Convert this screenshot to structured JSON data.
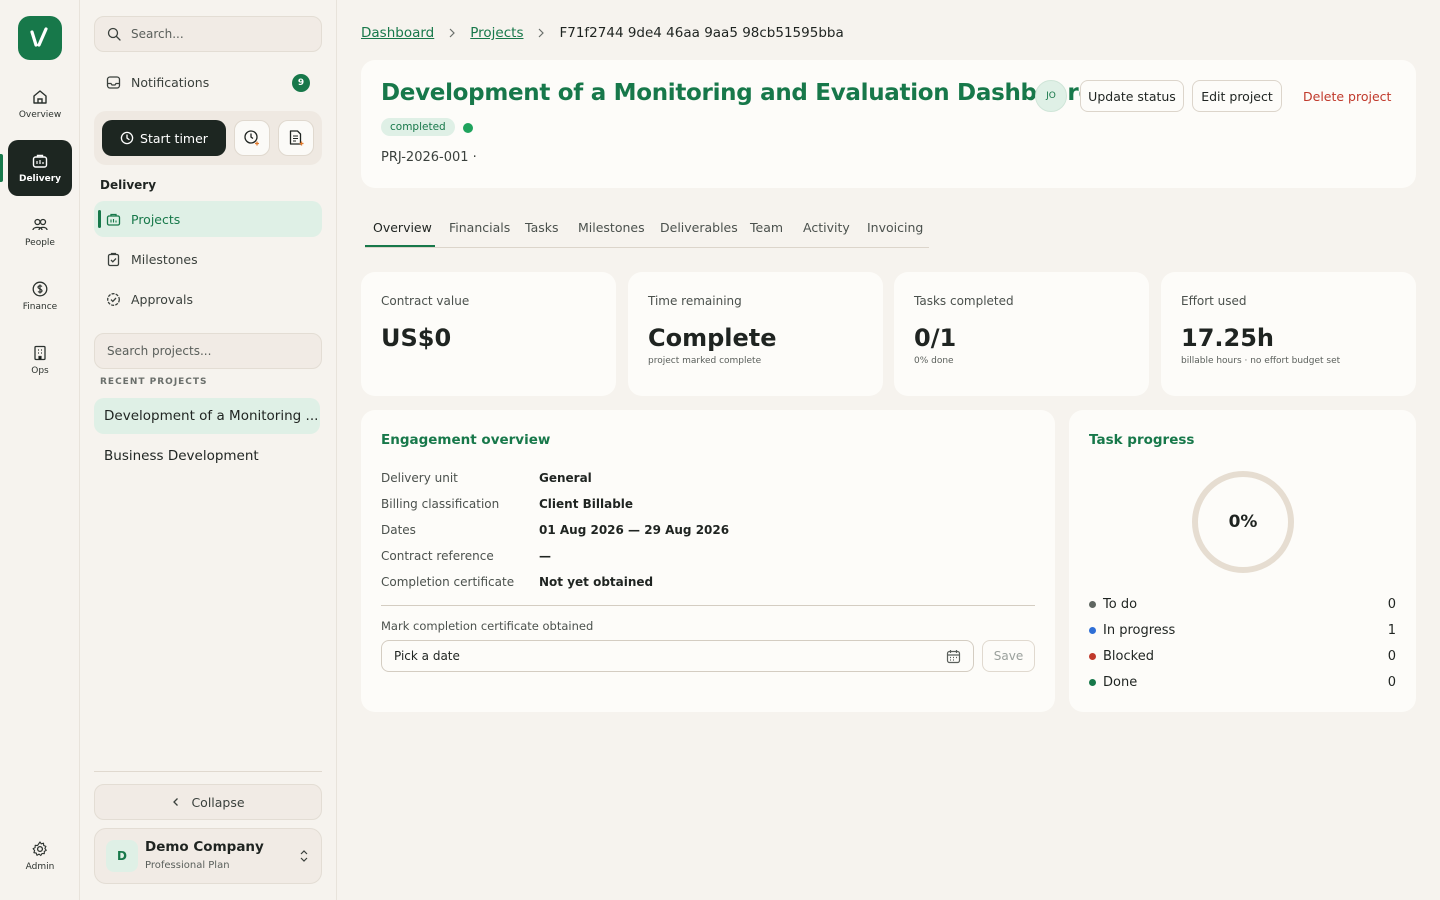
{
  "rail": {
    "items": [
      {
        "label": "Overview",
        "icon": "home-icon"
      },
      {
        "label": "Delivery",
        "icon": "briefcase-icon"
      },
      {
        "label": "People",
        "icon": "people-icon"
      },
      {
        "label": "Finance",
        "icon": "dollar-circle-icon"
      },
      {
        "label": "Ops",
        "icon": "building-icon"
      }
    ],
    "admin_label": "Admin"
  },
  "sidebar": {
    "search_placeholder": "Search...",
    "notifications_label": "Notifications",
    "notifications_count": "9",
    "start_timer_label": "Start timer",
    "section_label": "Delivery",
    "nav": [
      {
        "label": "Projects",
        "icon": "projects-icon"
      },
      {
        "label": "Milestones",
        "icon": "clipboard-check-icon"
      },
      {
        "label": "Approvals",
        "icon": "badge-check-icon"
      }
    ],
    "project_search_placeholder": "Search projects...",
    "recent_label": "RECENT PROJECTS",
    "recent_projects": [
      "Development of a Monitoring ...",
      "Business Development"
    ],
    "collapse_label": "Collapse",
    "company": {
      "initial": "D",
      "name": "Demo Company",
      "plan": "Professional Plan"
    }
  },
  "breadcrumb": {
    "items": [
      "Dashboard",
      "Projects"
    ],
    "current": "F71f2744 9de4 46aa 9aa5 98cb51595bba"
  },
  "project": {
    "title": "Development of a Monitoring and Evaluation Dashboard",
    "status": "completed",
    "code": "PRJ-2026-001 ·",
    "owner_initials": "JO",
    "actions": {
      "update_status": "Update status",
      "edit": "Edit project",
      "delete": "Delete project"
    }
  },
  "tabs": [
    "Overview",
    "Financials",
    "Tasks",
    "Milestones",
    "Deliverables",
    "Team",
    "Activity",
    "Invoicing"
  ],
  "stats": [
    {
      "label": "Contract value",
      "value": "US$0",
      "sub": ""
    },
    {
      "label": "Time remaining",
      "value": "Complete",
      "sub": "project marked complete"
    },
    {
      "label": "Tasks completed",
      "value": "0/1",
      "sub": "0% done"
    },
    {
      "label": "Effort used",
      "value": "17.25h",
      "sub": "billable hours · no effort budget set"
    }
  ],
  "engagement": {
    "title": "Engagement overview",
    "rows": [
      {
        "label": "Delivery unit",
        "value": "General"
      },
      {
        "label": "Billing classification",
        "value": "Client Billable"
      },
      {
        "label": "Dates",
        "value": "01 Aug 2026 — 29 Aug 2026"
      },
      {
        "label": "Contract reference",
        "value": "—"
      },
      {
        "label": "Completion certificate",
        "value": "Not yet obtained"
      }
    ],
    "mark_label": "Mark completion certificate obtained",
    "date_placeholder": "Pick a date",
    "save_label": "Save"
  },
  "task_progress": {
    "title": "Task progress",
    "percent": 0,
    "percent_label": "0%",
    "legend": [
      {
        "label": "To do",
        "count": "0",
        "color": "#5f6661"
      },
      {
        "label": "In progress",
        "count": "1",
        "color": "#2f6fd6"
      },
      {
        "label": "Blocked",
        "count": "0",
        "color": "#c0392b"
      },
      {
        "label": "Done",
        "count": "0",
        "color": "#17784a"
      }
    ]
  },
  "colors": {
    "brand": "#17784a",
    "danger": "#c0392b",
    "background": "#f6f3ee",
    "rail_active": "#1d2621"
  }
}
